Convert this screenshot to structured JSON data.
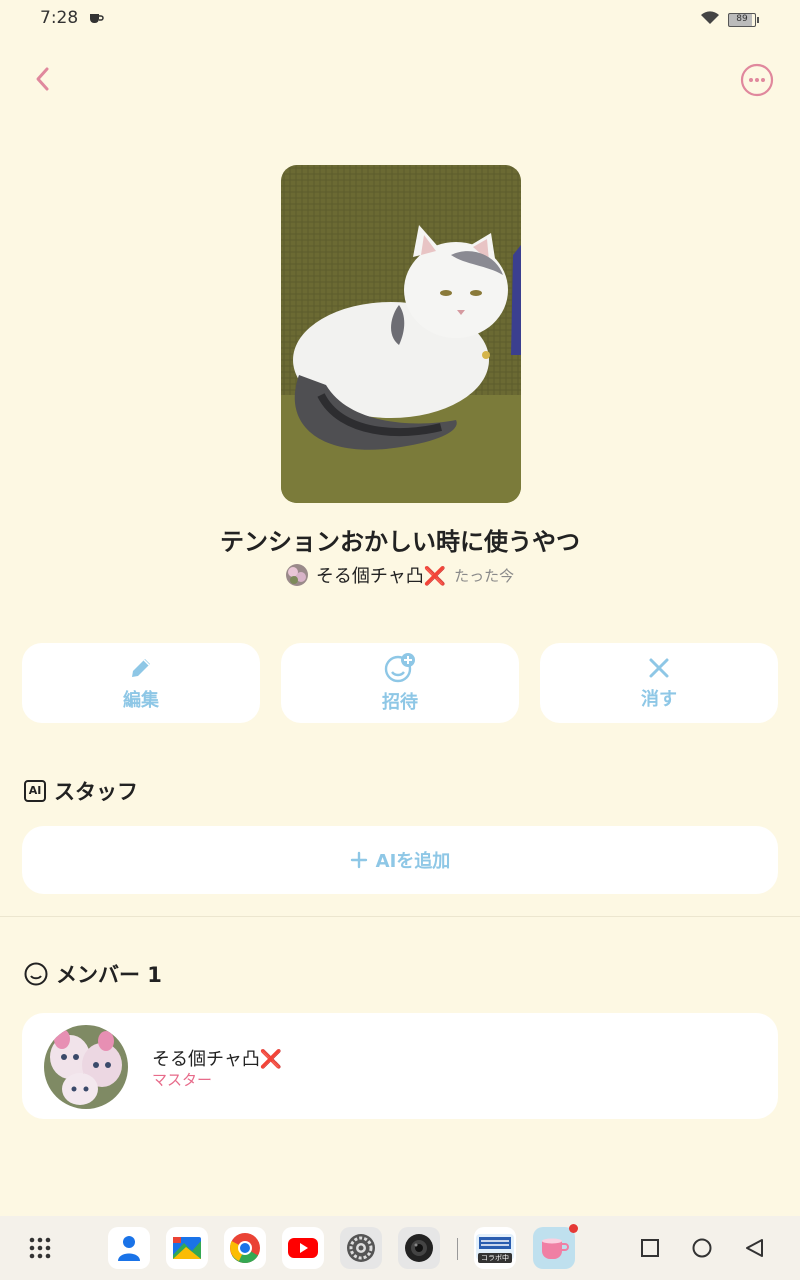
{
  "status": {
    "time": "7:28",
    "battery": "89"
  },
  "room": {
    "title": "テンションおかしい時に使うやつ",
    "owner_name": "そる個チャ凸❌",
    "updated": "たった今"
  },
  "actions": [
    {
      "label": "編集",
      "icon": "pencil-icon"
    },
    {
      "label": "招待",
      "icon": "add-person-icon"
    },
    {
      "label": "消す",
      "icon": "close-icon"
    }
  ],
  "staff": {
    "title": "スタッフ",
    "badge": "AI",
    "add_label": "AIを追加"
  },
  "members": {
    "title": "メンバー 1",
    "items": [
      {
        "name": "そる個チャ凸❌",
        "role": "マスター"
      }
    ]
  },
  "colors": {
    "background": "#fdf8e3",
    "accent_blue": "#8ec7e6",
    "accent_pink": "#e76b8a"
  },
  "taskbar": {
    "apps": [
      "app-drawer-icon",
      "contacts-icon",
      "files-icon",
      "chrome-icon",
      "youtube-icon",
      "settings-icon",
      "camera-icon",
      "collab-app-icon",
      "cup-app-icon"
    ],
    "collab_text": "コラボ中"
  }
}
